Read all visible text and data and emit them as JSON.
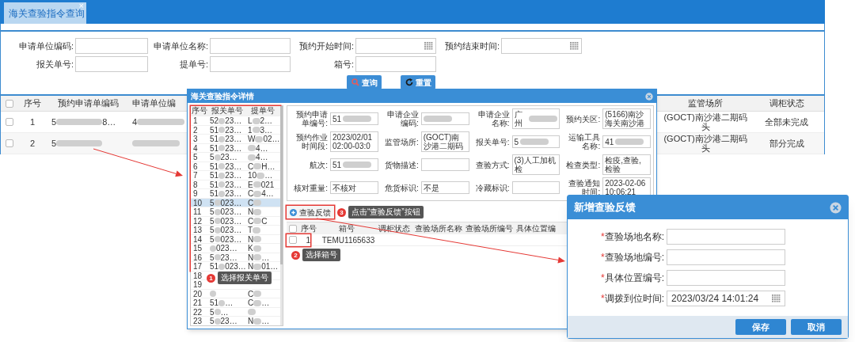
{
  "tab": {
    "label": "海关查验指令查询",
    "close": "×",
    "selected": true
  },
  "search": {
    "fields": [
      {
        "label": "申请单位编码:",
        "kind": "text"
      },
      {
        "label": "申请单位名称:",
        "kind": "text"
      },
      {
        "label": "预约开始时间:",
        "kind": "date"
      },
      {
        "label": "预约结束时间:",
        "kind": "date"
      },
      {
        "label": "报关单号:",
        "kind": "text"
      },
      {
        "label": "提单号:",
        "kind": "text"
      },
      {
        "label": "箱号:",
        "kind": "text"
      }
    ],
    "buttons": [
      {
        "label": "查询",
        "kind": "search"
      },
      {
        "label": "重置",
        "kind": "reset"
      }
    ]
  },
  "table": {
    "header_checked": false,
    "columns": [
      "序号",
      "预约申请单编码",
      "申请单位编",
      "监管场所",
      "调柜状态"
    ],
    "rows": [
      {
        "no": "1",
        "code": {
          "prefix": "5",
          "suffix": "8…"
        },
        "applicant": {
          "prefix": "4"
        },
        "site": "(GOCT)南沙港二期码头",
        "status": "全部未完成",
        "checked": false
      },
      {
        "no": "2",
        "code": {
          "prefix": "5"
        },
        "applicant": {},
        "site": "(GOCT)南沙港二期码头",
        "status": "部分完成",
        "checked": false
      }
    ]
  },
  "detail": {
    "title": "海关查验指令详情",
    "list": {
      "columns": [
        "序号",
        "报关单号",
        "提单号"
      ],
      "rows": [
        {
          "no": "1",
          "decl": {
            "prefix": "52",
            "suffix": "23…"
          },
          "bill": {
            "prefix": "L",
            "suffix": "2…"
          },
          "selected": false
        },
        {
          "no": "2",
          "decl": {
            "prefix": "51",
            "suffix": "23…"
          },
          "bill": {
            "prefix": "1",
            "suffix": "3…"
          },
          "selected": false
        },
        {
          "no": "3",
          "decl": {
            "prefix": "51",
            "suffix": "23…"
          },
          "bill": {
            "prefix": "W",
            "suffix": "02…"
          },
          "selected": false
        },
        {
          "no": "4",
          "decl": {
            "prefix": "51",
            "suffix": "23…"
          },
          "bill": {
            "suffix": "4…"
          },
          "selected": false
        },
        {
          "no": "5",
          "decl": {
            "prefix": "5",
            "suffix": "23…"
          },
          "bill": {
            "suffix": "4…"
          },
          "selected": false
        },
        {
          "no": "6",
          "decl": {
            "prefix": "51",
            "suffix": "23…"
          },
          "bill": {
            "prefix": "C",
            "suffix": "H…"
          },
          "selected": false
        },
        {
          "no": "7",
          "decl": {
            "prefix": "51",
            "suffix": "23…"
          },
          "bill": {
            "prefix": "10",
            "suffix": "…"
          },
          "selected": false
        },
        {
          "no": "8",
          "decl": {
            "prefix": "51",
            "suffix": "23…"
          },
          "bill": {
            "prefix": "E",
            "suffix": "021"
          },
          "selected": false
        },
        {
          "no": "9",
          "decl": {
            "prefix": "51",
            "suffix": "23…"
          },
          "bill": {
            "prefix": "C",
            "suffix": "4…"
          },
          "selected": false
        },
        {
          "no": "10",
          "decl": {
            "prefix": "5",
            "suffix": "023…"
          },
          "bill": {
            "prefix": "C"
          },
          "selected": true
        },
        {
          "no": "11",
          "decl": {
            "prefix": "5",
            "suffix": "023…"
          },
          "bill": {
            "prefix": "N"
          },
          "selected": false
        },
        {
          "no": "12",
          "decl": {
            "prefix": "5",
            "suffix": "023…"
          },
          "bill": {
            "prefix": "C",
            "suffix": "C"
          },
          "selected": false
        },
        {
          "no": "13",
          "decl": {
            "prefix": "5",
            "suffix": "023…"
          },
          "bill": {
            "prefix": "T"
          },
          "selected": false
        },
        {
          "no": "14",
          "decl": {
            "prefix": "5",
            "suffix": "023…"
          },
          "bill": {
            "prefix": "N"
          },
          "selected": false
        },
        {
          "no": "15",
          "decl": {
            "suffix": "023…"
          },
          "bill": {
            "prefix": "K"
          },
          "selected": false
        },
        {
          "no": "16",
          "decl": {
            "prefix": "5",
            "suffix": "23…"
          },
          "bill": {
            "prefix": "N",
            "suffix": "…"
          },
          "selected": false
        },
        {
          "no": "17",
          "decl": {
            "prefix": "51",
            "suffix": "023…"
          },
          "bill": {
            "prefix": "N",
            "suffix": "01…"
          },
          "selected": false
        },
        {
          "no": "18",
          "selected": false
        },
        {
          "no": "19",
          "selected": false
        },
        {
          "no": "20",
          "decl": {},
          "bill": {
            "prefix": "C"
          },
          "selected": false
        },
        {
          "no": "21",
          "decl": {
            "prefix": "51",
            "suffix": "…"
          },
          "bill": {
            "prefix": "C",
            "suffix": "…"
          },
          "selected": false
        },
        {
          "no": "22",
          "decl": {
            "prefix": "5",
            "suffix": "…"
          },
          "bill": {},
          "selected": false
        },
        {
          "no": "23",
          "decl": {
            "prefix": "5",
            "suffix": "23…"
          },
          "bill": {
            "prefix": "N",
            "suffix": "…"
          },
          "selected": false
        }
      ]
    },
    "form": [
      {
        "label": "预约申请单编号:",
        "value": "51",
        "redacted": true
      },
      {
        "label": "申请企业编码:",
        "redacted": true
      },
      {
        "label": "申请企业名称:",
        "value": "广州",
        "redacted": true
      },
      {
        "label": "预约关区:",
        "value": "(5166)南沙海关南沙港",
        "redacted": false
      },
      {
        "label": "预约作业时间段:",
        "value": "2023/02/01 02:00-03:0",
        "redacted": false
      },
      {
        "label": "监管场所:",
        "value": "(GOCT)南沙港二期码",
        "redacted": false
      },
      {
        "label": "报关单号:",
        "value": "5",
        "redacted": true
      },
      {
        "label": "运输工具名称:",
        "value": "41",
        "redacted": true
      },
      {
        "label": "航次:",
        "value": "51",
        "redacted": true
      },
      {
        "label": "货物描述:",
        "redacted": false
      },
      {
        "label": "查验方式:",
        "value": "(3)人工加机检",
        "redacted": false
      },
      {
        "label": "检查类型:",
        "value": "检疫,查验,检验",
        "redacted": false
      },
      {
        "label": "核对重量:",
        "value": "不核对",
        "redacted": false
      },
      {
        "label": "危货标识:",
        "value": "不是",
        "redacted": false
      },
      {
        "label": "冷藏标识:",
        "redacted": false
      },
      {
        "label": "查验通知时间:",
        "value": "2023-02-06 10:06:21",
        "redacted": false
      }
    ],
    "toolbar": {
      "button": "查验反馈"
    },
    "grid": {
      "header_checked": false,
      "columns": [
        "序号",
        "箱号",
        "调柜状态",
        "查验场所名称",
        "查验场所编号",
        "具体位置编"
      ],
      "rows": [
        {
          "no": "1",
          "box": "TEMU1165633",
          "checked": false
        }
      ]
    },
    "annotations": [
      {
        "number": "1",
        "text": "选择报关单号"
      },
      {
        "number": "2",
        "text": "选择箱号"
      },
      {
        "number": "3",
        "text": "点击“查验反馈”按钮"
      }
    ]
  },
  "feedback_dialog": {
    "title": "新增查验反馈",
    "fields": [
      {
        "mark": "*",
        "label": "查验场地名称:",
        "kind": "text"
      },
      {
        "mark": "*",
        "label": "查验场地编号:",
        "kind": "text"
      },
      {
        "mark": "*",
        "label": "具体位置编号:",
        "kind": "text"
      },
      {
        "mark": "*",
        "label": "调拨到位时间:",
        "kind": "date",
        "value": "2023/03/24 14:01:24"
      }
    ],
    "buttons": [
      "保存",
      "取消"
    ]
  }
}
